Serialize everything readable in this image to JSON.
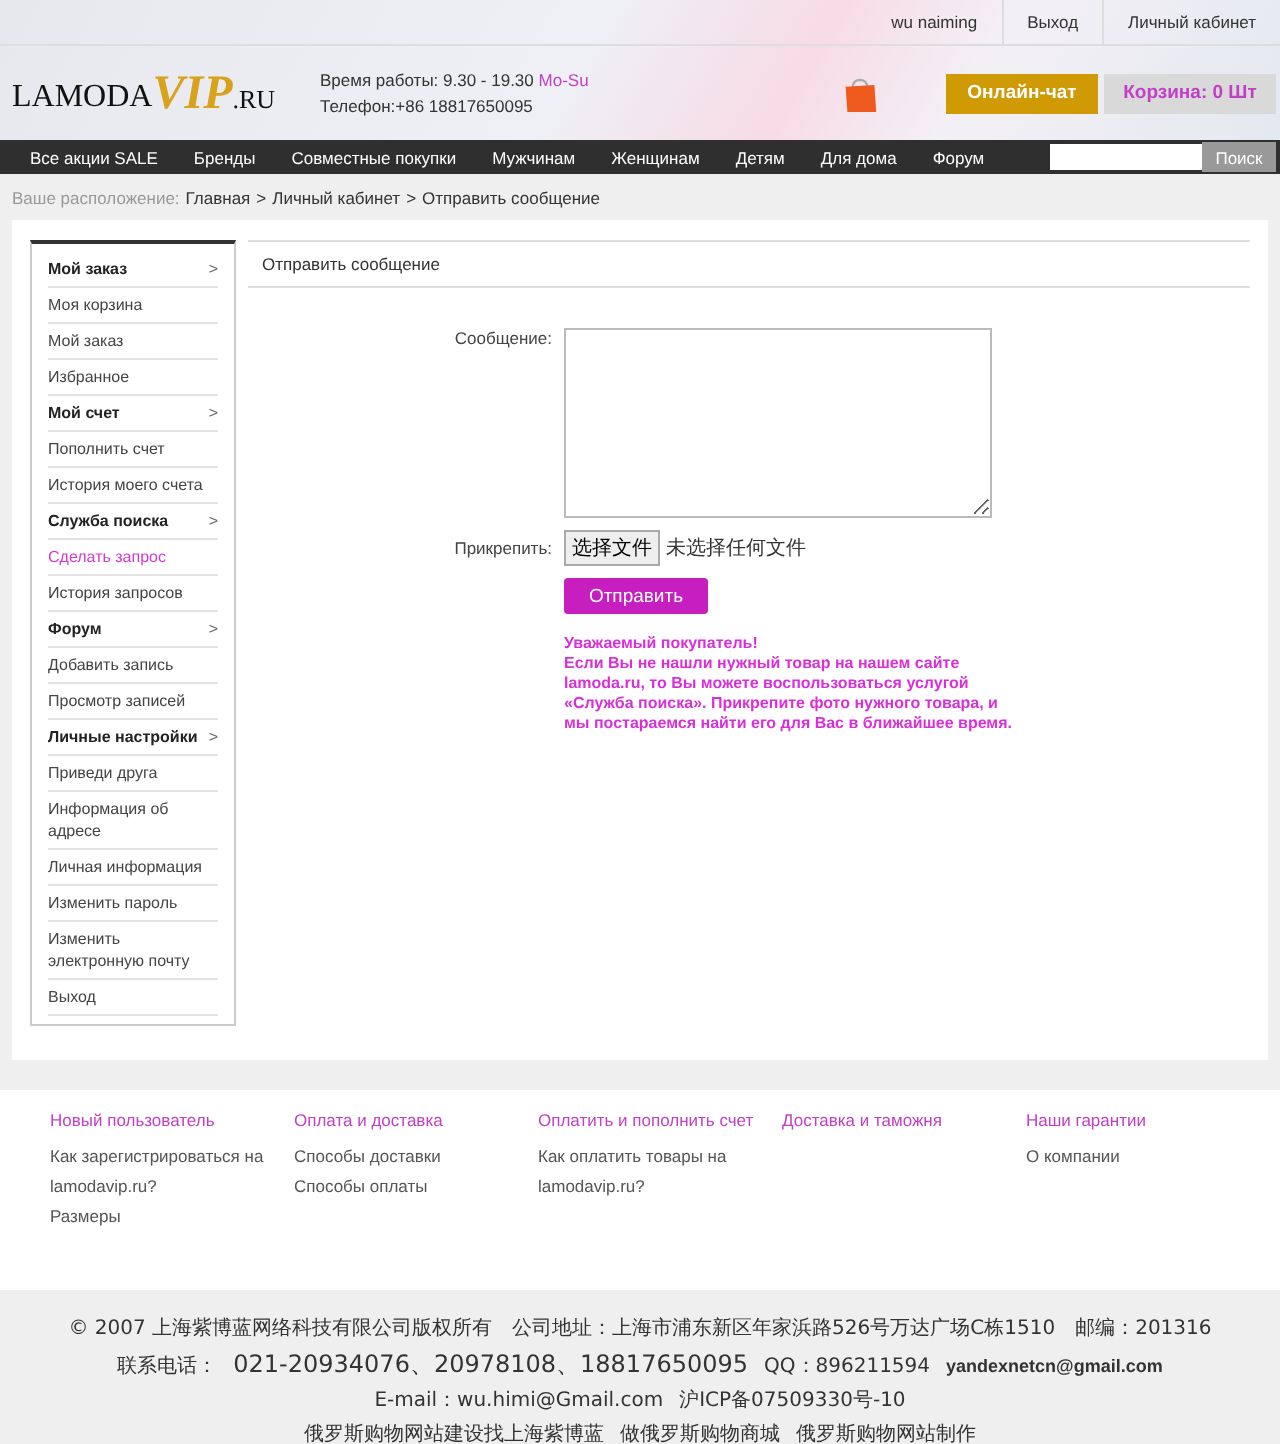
{
  "top_links": [
    {
      "label": "wu naiming"
    },
    {
      "label": "Выход"
    },
    {
      "label": "Личный кабинет"
    }
  ],
  "logo": {
    "main": "LAMODA",
    "accent": "VIP",
    "suffix": ".RU"
  },
  "hours": {
    "text": "Время работы: 9.30 - 19.30",
    "days": "Mo-Su"
  },
  "phone": "Телефон:+86 18817650095",
  "chat_button": "Онлайн-чат",
  "cart_button": "Корзина: 0 Шт",
  "nav": [
    "Все акции SALE",
    "Бренды",
    "Совместные покупки",
    "Мужчинам",
    "Женщинам",
    "Детям",
    "Для дома",
    "Форум"
  ],
  "search": {
    "button": "Поиск"
  },
  "breadcrumb": {
    "label": "Ваше расположение:",
    "path": [
      "Главная",
      "Личный кабинет",
      "Отправить сообщение"
    ],
    "separator": ">"
  },
  "sidebar": [
    {
      "kind": "section",
      "label": "Мой заказ",
      "arrow": ">",
      "selected": false
    },
    {
      "kind": "link",
      "label": "Моя корзина",
      "selected": false
    },
    {
      "kind": "link",
      "label": "Мой заказ",
      "selected": false
    },
    {
      "kind": "link",
      "label": "Избранное",
      "selected": false
    },
    {
      "kind": "section",
      "label": "Мой счет",
      "arrow": ">",
      "selected": false
    },
    {
      "kind": "link",
      "label": "Пополнить счет",
      "selected": false
    },
    {
      "kind": "link",
      "label": "История моего счета",
      "selected": false
    },
    {
      "kind": "section",
      "label": "Служба поиска",
      "arrow": ">",
      "selected": false
    },
    {
      "kind": "link",
      "label": "Сделать запрос",
      "selected": true
    },
    {
      "kind": "link",
      "label": "История запросов",
      "selected": false
    },
    {
      "kind": "section",
      "label": "Форум",
      "arrow": ">",
      "selected": false
    },
    {
      "kind": "link",
      "label": "Добавить запись",
      "selected": false
    },
    {
      "kind": "link",
      "label": "Просмотр записей",
      "selected": false
    },
    {
      "kind": "section",
      "label": "Личные настройки",
      "arrow": ">",
      "selected": false
    },
    {
      "kind": "link",
      "label": "Приведи друга",
      "selected": false
    },
    {
      "kind": "link",
      "label": "Информация об адресе",
      "selected": false
    },
    {
      "kind": "link",
      "label": "Личная информация",
      "selected": false
    },
    {
      "kind": "link",
      "label": "Изменить пароль",
      "selected": false
    },
    {
      "kind": "link",
      "label": "Изменить электронную почту",
      "selected": false
    },
    {
      "kind": "link",
      "label": "Выход",
      "selected": false
    }
  ],
  "content": {
    "title": "Отправить сообщение",
    "message_label": "Сообщение:",
    "attach_label": "Прикрепить:",
    "file_button": "选择文件",
    "file_status": "未选择任何文件",
    "submit": "Отправить",
    "notice_title": "Уважаемый покупатель!",
    "notice_text": "Если Вы не нашли нужный товар на нашем сайте lamoda.ru, то Вы можете воспользоваться услугой «Служба поиска». Прикрепите фото нужного товара,  и мы постараемся найти его для Вас в ближайшее время."
  },
  "footer_columns": [
    {
      "heading": "Новый пользователь",
      "links": [
        "Как зарегистрироваться на lamodavip.ru?",
        "Размеры"
      ]
    },
    {
      "heading": "Оплата и доставка",
      "links": [
        "Способы доставки",
        "Способы оплаты"
      ]
    },
    {
      "heading": "Оплатить и пополнить счет",
      "links": [
        "Как оплатить товары на lamodavip.ru?"
      ]
    },
    {
      "heading": "Доставка и таможня"
    },
    {
      "heading": "Наши гарантии",
      "links": [
        "О компании"
      ]
    }
  ],
  "bottom": {
    "copyright": "© 2007 上海紫博蓝网络科技有限公司版权所有　公司地址：上海市浦东新区年家浜路526号万达广场C栋1510　邮编：201316",
    "contacts": [
      {
        "kind": "plain",
        "text": "联系电话："
      },
      {
        "kind": "large",
        "text": "021-20934076、20978108、18817650095"
      },
      {
        "kind": "plain",
        "text": "QQ：896211594"
      },
      {
        "kind": "bold",
        "text": "yandexnetcn@gmail.com"
      },
      {
        "kind": "plain",
        "text": "E-mail：wu.himi@Gmail.com"
      },
      {
        "kind": "plain",
        "text": "沪ICP备07509330号-10"
      }
    ],
    "links": [
      "俄罗斯购物网站建设找上海紫博蓝",
      "做俄罗斯购物商城",
      "俄罗斯购物网站制作"
    ]
  }
}
